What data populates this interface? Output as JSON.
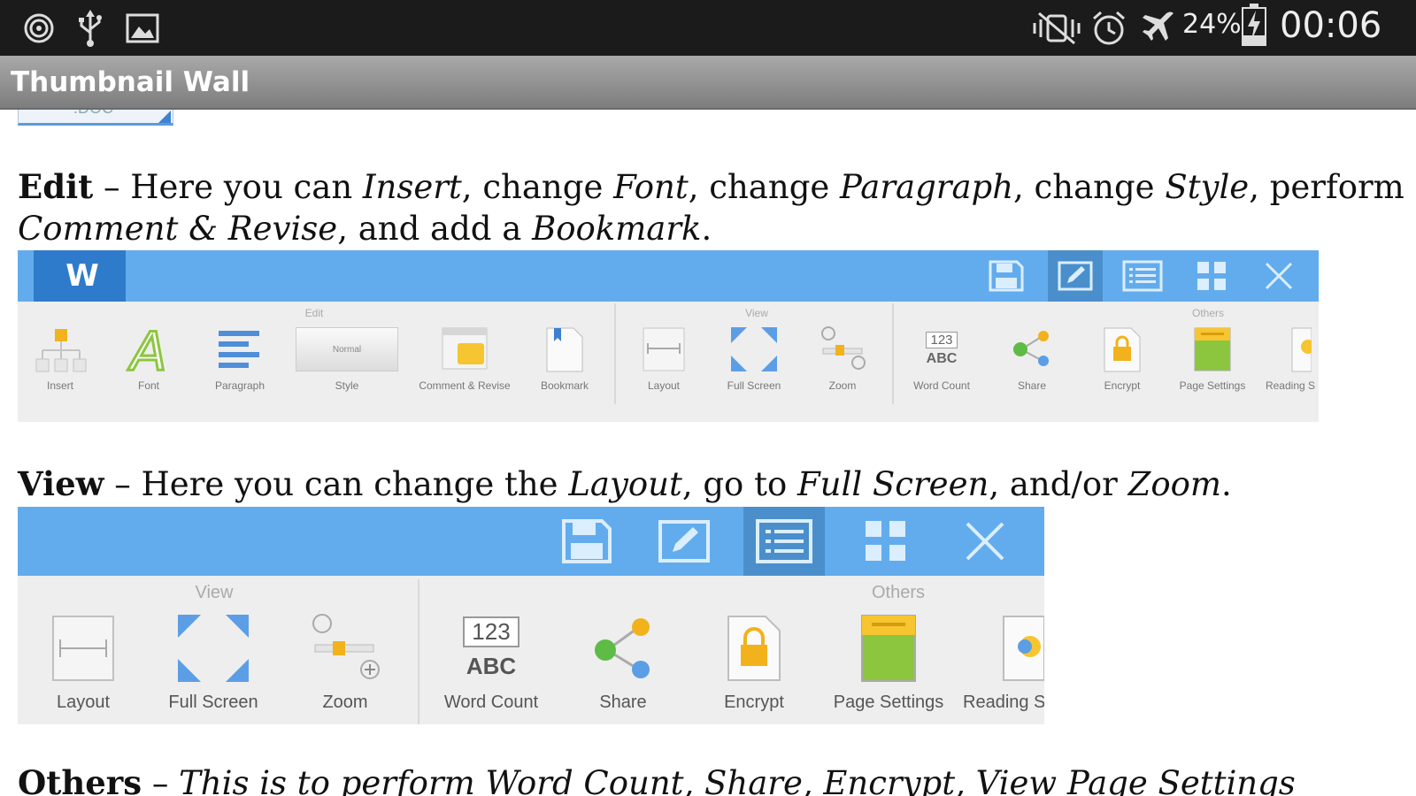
{
  "status_bar": {
    "battery": "24%",
    "time": "00:06",
    "left_icons": [
      "radio-icon",
      "usb-icon",
      "image-icon"
    ],
    "right_icons": [
      "vibrate-mute-icon",
      "alarm-icon",
      "airplane-icon",
      "battery-charging-icon"
    ]
  },
  "action_bar": {
    "title": "Thumbnail Wall"
  },
  "doc_thumb": {
    "label": ".DOC"
  },
  "edit_para": {
    "lead": "Edit",
    "t1": " – Here you can ",
    "i1": "Insert",
    "t2": ", change ",
    "i2": "Font",
    "t3": ", change ",
    "i3": "Paragraph",
    "t4": ", change ",
    "i4": "Style",
    "t5": ", perform",
    "i5": "Comment & Revise",
    "t6": ", and add a ",
    "i6": "Bookmark",
    "t7": "."
  },
  "edit_shot": {
    "logo": "W",
    "groups": {
      "edit": "Edit",
      "view": "View",
      "others": "Others"
    },
    "items": [
      "Insert",
      "Font",
      "Paragraph",
      "Style",
      "Comment & Revise",
      "Bookmark",
      "Layout",
      "Full Screen",
      "Zoom",
      "Word Count",
      "Share",
      "Encrypt",
      "Page Settings",
      "Reading S"
    ],
    "style_sample": "Normal",
    "wc_top": "123",
    "wc_bottom": "ABC"
  },
  "view_para": {
    "lead": "View",
    "t1": " – Here you can change the ",
    "i1": "Layout",
    "t2": ", go to ",
    "i2": "Full Screen",
    "t3": ", and/or ",
    "i3": "Zoom",
    "t4": "."
  },
  "view_shot": {
    "groups": {
      "view": "View",
      "others": "Others"
    },
    "items": [
      "Layout",
      "Full Screen",
      "Zoom",
      "Word Count",
      "Share",
      "Encrypt",
      "Page Settings",
      "Reading S"
    ],
    "wc_top": "123",
    "wc_bottom": "ABC"
  },
  "others_para": {
    "lead": "Others",
    "t1": " – ",
    "text": "This is to perform Word Count, Share, Encrypt, View Page Settings"
  }
}
